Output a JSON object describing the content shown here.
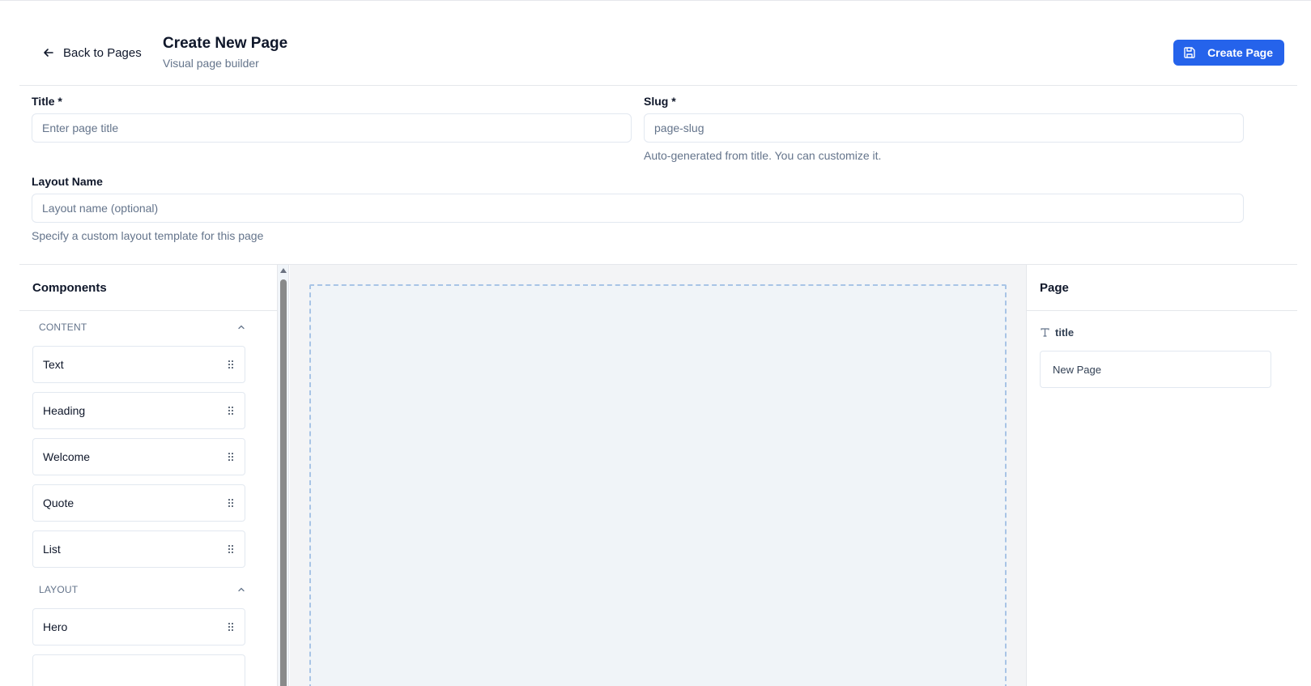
{
  "header": {
    "back_label": "Back to Pages",
    "title": "Create New Page",
    "subtitle": "Visual page builder",
    "create_label": "Create Page"
  },
  "form": {
    "title_label": "Title *",
    "title_placeholder": "Enter page title",
    "title_value": "",
    "slug_label": "Slug *",
    "slug_placeholder": "page-slug",
    "slug_value": "",
    "slug_hint": "Auto-generated from title. You can customize it.",
    "layout_label": "Layout Name",
    "layout_placeholder": "Layout name (optional)",
    "layout_value": "",
    "layout_hint": "Specify a custom layout template for this page"
  },
  "components": {
    "heading": "Components",
    "sections": [
      {
        "name": "CONTENT",
        "items": [
          "Text",
          "Heading",
          "Welcome",
          "Quote",
          "List"
        ]
      },
      {
        "name": "LAYOUT",
        "items": [
          "Hero",
          ""
        ]
      }
    ]
  },
  "properties": {
    "heading": "Page",
    "field_label": "title",
    "field_value": "New Page"
  },
  "colors": {
    "accent": "#2563eb",
    "border": "#e2e8f0",
    "muted_text": "#64748b",
    "drop_zone_border": "#a8c4e6"
  },
  "icons": {
    "back": "arrow-left-icon",
    "save": "save-icon",
    "collapse": "chevron-up-icon",
    "drag": "grip-vertical-icon",
    "text_type": "type-icon"
  }
}
